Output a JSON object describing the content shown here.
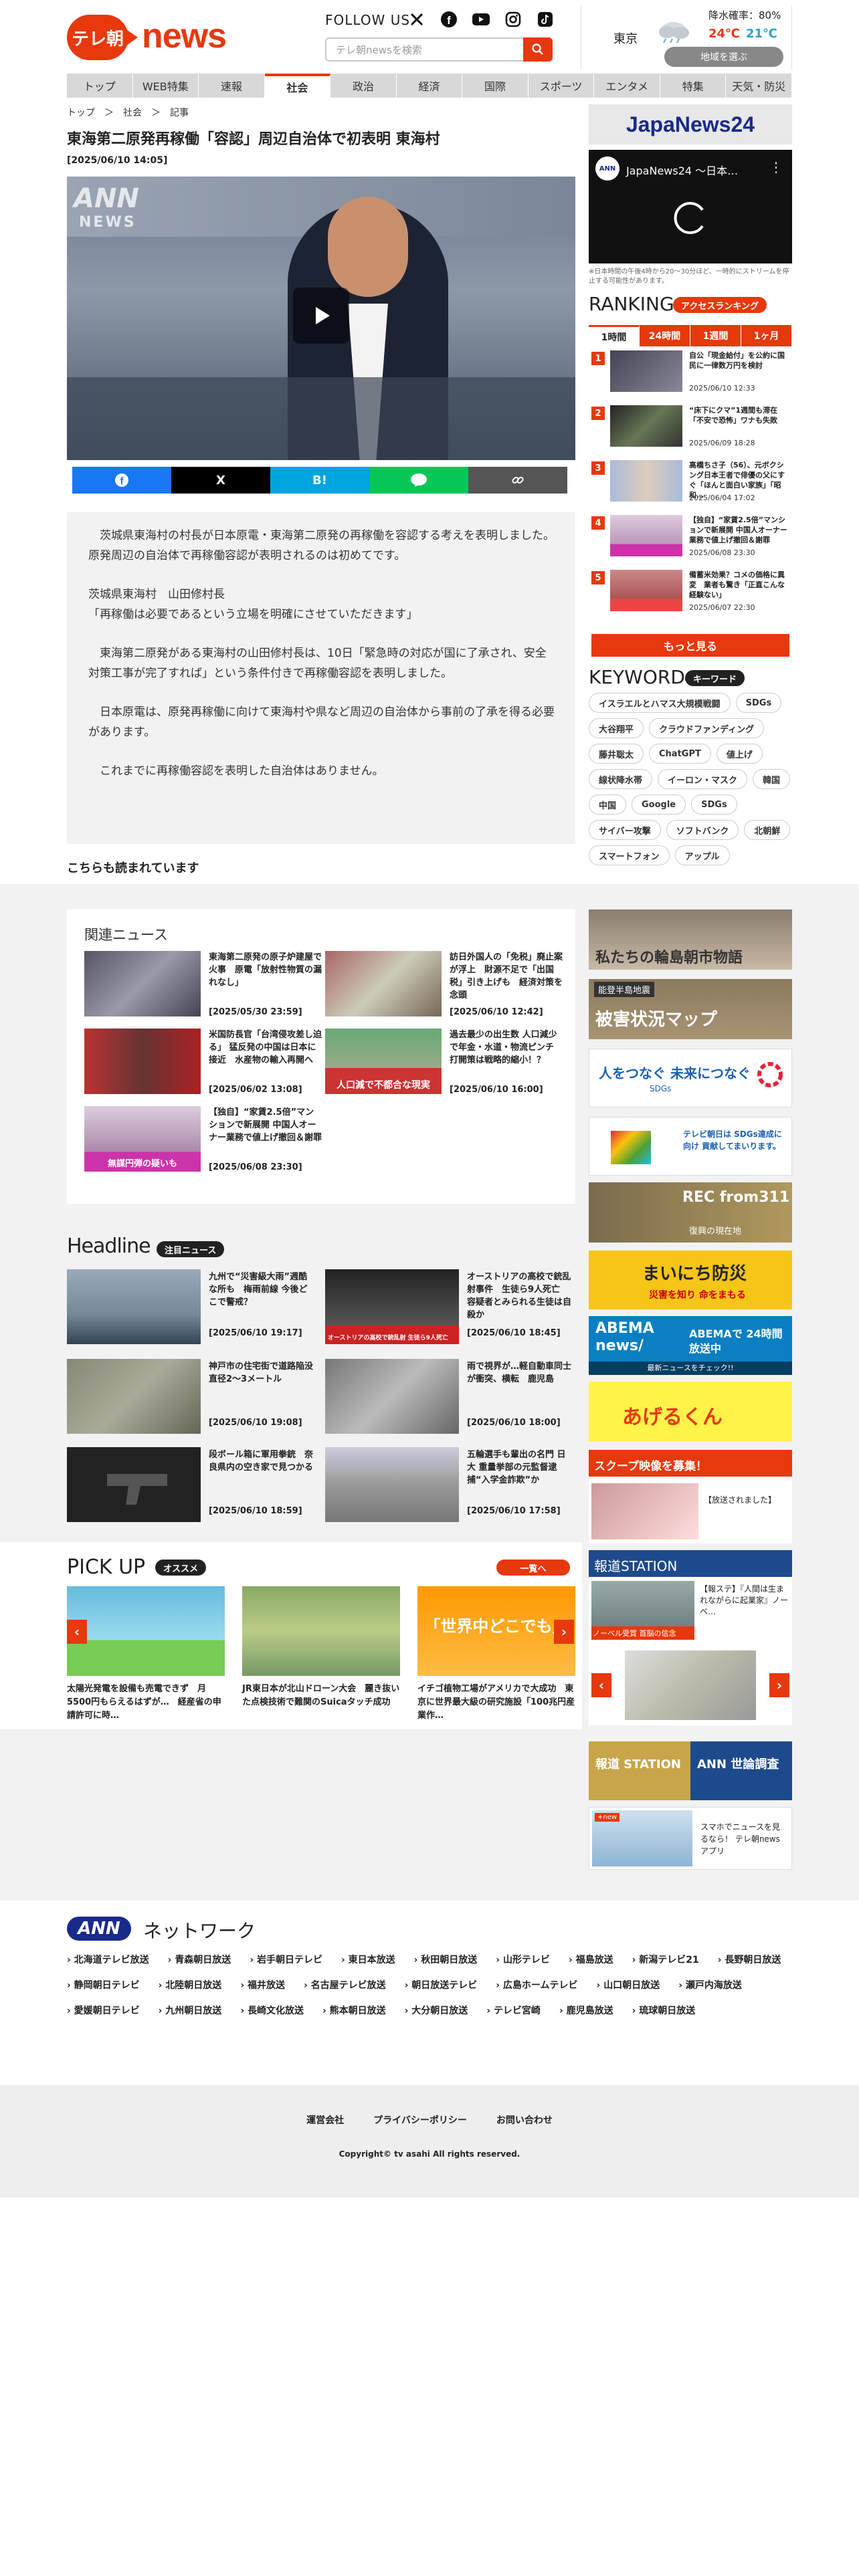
{
  "header": {
    "logo_mark": "テレ朝",
    "logo_text": "news",
    "follow": "FOLLOW US",
    "search_placeholder": "テレ朝newsを検索"
  },
  "weather": {
    "city": "東京",
    "rain": "降水確率：80%",
    "high": "24℃",
    "low": "21℃",
    "area_button": "地域を選ぶ"
  },
  "nav": [
    "トップ",
    "WEB特集",
    "速報",
    "社会",
    "政治",
    "経済",
    "国際",
    "スポーツ",
    "エンタメ",
    "特集",
    "天気・防災"
  ],
  "breadcrumb": "トップ　＞　社会　＞　記事",
  "article": {
    "title": "東海第二原発再稼働「容認」周辺自治体で初表明 東海村",
    "date": "[2025/06/10 14:05]",
    "video_logo": "ANN",
    "video_logo_sub": "NEWS",
    "share": [
      "",
      "X",
      "B!",
      "",
      ""
    ],
    "body": [
      "　茨城県東海村の村長が日本原電・東海第二原発の再稼働を容認する考えを表明しました。原発周辺の自治体で再稼働容認が表明されるのは初めてです。",
      "茨城県東海村　山田修村長\n「再稼働は必要であるという立場を明確にさせていただきます」",
      "　東海第二原発がある東海村の山田修村長は、10日「緊急時の対応が国に了承され、安全対策工事が完了すれば」という条件付きで再稼働容認を表明しました。",
      "　日本原電は、原発再稼働に向けて東海村や県など周辺の自治体から事前の了承を得る必要があります。",
      "　これまでに再稼働容認を表明した自治体はありません。"
    ]
  },
  "also_read": "こちらも読まれています",
  "related": {
    "title": "関連ニュース",
    "items": [
      {
        "text": "東海第二原発の原子炉建屋で火事　原電「放射性物質の漏れなし」",
        "date": "[2025/05/30 23:59]"
      },
      {
        "text": "訪日外国人の「免税」廃止案が浮上　財源不足で「出国税」引き上げも　経済対策を念頭",
        "date": "[2025/06/10 12:42]"
      },
      {
        "text": "米国防長官「台湾侵攻差し迫る」 猛反発の中国は日本に接近　水産物の輸入再開へ",
        "date": "[2025/06/02 13:08]"
      },
      {
        "text": "過去最少の出生数 人口減少で年金・水道・物流ピンチ 打開策は戦略的縮小！？",
        "date": "[2025/06/10 16:00]"
      },
      {
        "text": "【独自】“家賃2.5倍”マンションで新展開 中国人オーナー業務で値上げ撤回＆謝罪",
        "date": "[2025/06/08 23:30]"
      }
    ],
    "thumb_caption_4": "人口減で不都合な現実",
    "thumb_caption_5": "無謀円弾の疑いも"
  },
  "headline": {
    "title": "Headline",
    "badge": "注目ニュース",
    "items": [
      {
        "text": "九州で“災害級大雨”週酷な所も　梅雨前線 今後どこで警戒？",
        "date": "[2025/06/10 19:17]"
      },
      {
        "text": "オーストリアの高校で銃乱射事件　生徒ら9人死亡　容疑者とみられる生徒は自殺か",
        "date": "[2025/06/10 18:45]"
      },
      {
        "text": "神戸市の住宅街で道路陥没　直径2〜3メートル",
        "date": "[2025/06/10 19:08]"
      },
      {
        "text": "雨で視界が…軽自動車同士が衝突、横転　鹿児島",
        "date": "[2025/06/10 18:00]"
      },
      {
        "text": "段ボール箱に軍用拳銃　奈良県内の空き家で見つかる",
        "date": "[2025/06/10 18:59]"
      },
      {
        "text": "五輪選手も輩出の名門 日大 重量挙部の元監督逮捕“入学金詐欺”か",
        "date": "[2025/06/10 17:58]"
      }
    ],
    "caption_2": "オーストリアの高校で銃乱射 生徒ら9人死亡"
  },
  "pickup": {
    "title": "PICK UP",
    "badge": "オススメ",
    "more": "一覧へ",
    "items": [
      {
        "text": "太陽光発電を設備も売電できず　月5500円もらえるはずが…　経産省の申請許可に時…"
      },
      {
        "text": "JR東日本が北山ドローン大会　麗き抜いた点検技術で難関のSuicaタッチ成功"
      },
      {
        "text": "イチゴ植物工場がアメリカで大成功　東京に世界最大級の研究施設「100兆円産業作…"
      }
    ],
    "caption_3": "「世界中どこでも」"
  },
  "sidebar": {
    "japannews": "JapaNews24",
    "yt_title": "JapaNews24 ～日本…",
    "yt_note": "※日本時間の午後4時から20〜30分ほど、一時的にストリームを停止する可能性があります。",
    "ranking_title": "RANKING",
    "ranking_badge": "アクセスランキング",
    "tabs": [
      "1時間",
      "24時間",
      "1週間",
      "1ヶ月"
    ],
    "ranks": [
      {
        "no": "1",
        "text": "自公「現金給付」を公約に国民に一律数万円を検討",
        "date": "2025/06/10 12:33"
      },
      {
        "no": "2",
        "text": "“床下にクマ”1週間も滞在「不安で恐怖」ワナも失敗",
        "date": "2025/06/09 18:28"
      },
      {
        "no": "3",
        "text": "高橋ちさ子（56）、元ボクシング日本王者で俳優の父にすぐ「ほんと面白い家族」「昭和…",
        "date": "2025/06/04 17:02"
      },
      {
        "no": "4",
        "text": "【独自】“家賃2.5倍”マンションで新展開 中国人オーナー業務で値上げ撤回＆謝罪",
        "date": "2025/06/08 23:30"
      },
      {
        "no": "5",
        "text": "備蓄米効果？コメの価格に異変　業者も驚き「正直こんな経験ない」",
        "date": "2025/06/07 22:30"
      }
    ],
    "more": "もっと見る",
    "keyword_title": "KEYWORD",
    "keyword_badge": "キーワード",
    "keywords": [
      "イスラエルとハマス大規模戦闘",
      "SDGs",
      "大谷翔平",
      "クラウドファンディング",
      "藤井聡太",
      "ChatGPT",
      "値上げ",
      "線状降水帯",
      "イーロン・マスク",
      "韓国",
      "中国",
      "Google",
      "SDGs",
      "サイバー攻撃",
      "ソフトバンク",
      "北朝鮮",
      "スマートフォン",
      "アップル"
    ],
    "banners": {
      "wajima": "私たちの輪島朝市物語",
      "noto": "能登半島地震",
      "noto_main": "被害状況マップ",
      "sdgs": "人をつなぐ 未来につなぐ",
      "sdgs_sub": "SDGs",
      "sdgs2": "テレビ朝日は SDGs達成に向け 貢献してまいります。",
      "rec": "REC from311",
      "rec_sub": "復興の現在地",
      "bousai": "まいにち防災",
      "bousai_sub": "災害を知り 命をまもる",
      "abema": "ABEMA news/",
      "abema_sub": "ABEMAで 24時間放送中",
      "abema_note": "最新ニュースをチェック!!",
      "ageru": "あげるくん",
      "scoop": "スクープ映像を募集！",
      "scoop_caption": "【放送されました】",
      "hodo": "報道STATION",
      "hodo_text": "【報ステ】『人間は生まれながらに起業家』ノーベ…",
      "hodo_cap": "ノーベル受賞 首脳の信念",
      "survey_left": "報道 STATION",
      "survey_right": "ANN 世論調査",
      "app": "スマホでニュースを見るなら！ テレ朝newsアプリ",
      "app_new": "+new"
    }
  },
  "network": {
    "logo": "ANN",
    "title": "ネットワーク",
    "stations": [
      "北海道テレビ放送",
      "青森朝日放送",
      "岩手朝日テレビ",
      "東日本放送",
      "秋田朝日放送",
      "山形テレビ",
      "福島放送",
      "新潟テレビ21",
      "長野朝日放送",
      "静岡朝日テレビ",
      "北陸朝日放送",
      "福井放送",
      "名古屋テレビ放送",
      "朝日放送テレビ",
      "広島ホームテレビ",
      "山口朝日放送",
      "瀬戸内海放送",
      "愛媛朝日テレビ",
      "九州朝日放送",
      "長崎文化放送",
      "熊本朝日放送",
      "大分朝日放送",
      "テレビ宮崎",
      "鹿児島放送",
      "琉球朝日放送"
    ]
  },
  "footer": {
    "links": [
      "運営会社",
      "プライバシーポリシー",
      "お問い合わせ"
    ],
    "copyright": "Copyright© tv asahi All rights reserved."
  }
}
